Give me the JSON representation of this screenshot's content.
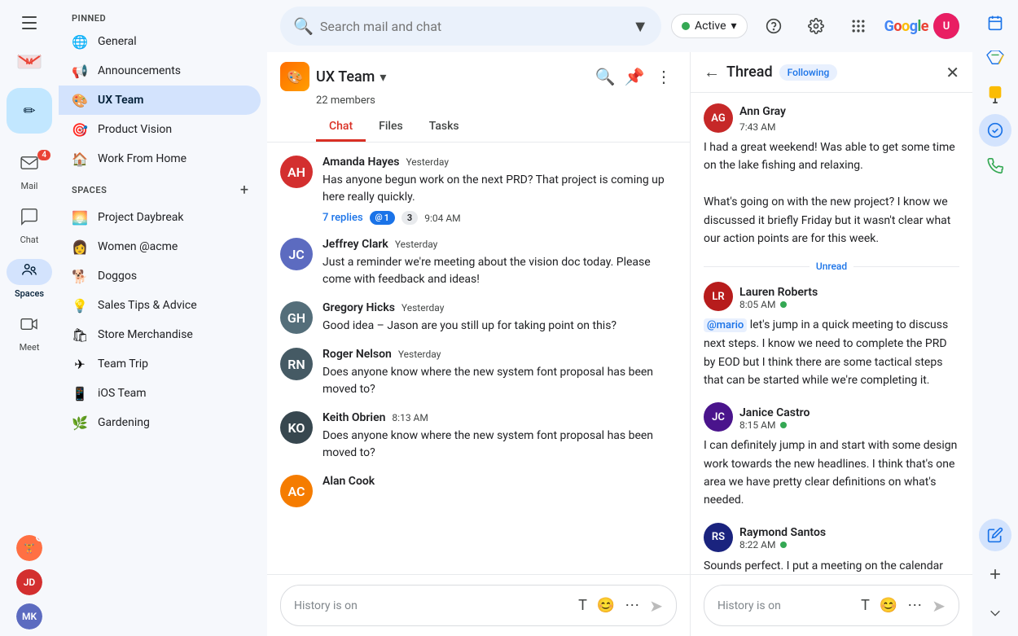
{
  "app": {
    "title": "Gmail",
    "search_placeholder": "Search mail and chat"
  },
  "top_bar": {
    "active_status": "Active",
    "help_label": "Help",
    "settings_label": "Settings",
    "apps_label": "Google apps"
  },
  "left_rail": {
    "hamburger_label": "Main menu",
    "compose_label": "Compose",
    "nav_items": [
      {
        "id": "mail",
        "label": "Mail",
        "icon": "✉",
        "badge": "4"
      },
      {
        "id": "chat",
        "label": "Chat",
        "icon": "💬",
        "badge": null
      },
      {
        "id": "spaces",
        "label": "Spaces",
        "icon": "👥",
        "active": true,
        "badge": null
      },
      {
        "id": "meet",
        "label": "Meet",
        "icon": "📹",
        "badge": null
      }
    ]
  },
  "sidebar": {
    "pinned_label": "PINNED",
    "pinned_items": [
      {
        "id": "general",
        "label": "General",
        "icon": "🌐"
      },
      {
        "id": "announcements",
        "label": "Announcements",
        "icon": "📢"
      },
      {
        "id": "ux-team",
        "label": "UX Team",
        "icon": "🎨",
        "active": true
      },
      {
        "id": "product-vision",
        "label": "Product Vision",
        "icon": "🎯"
      },
      {
        "id": "work-from-home",
        "label": "Work From Home",
        "icon": "🏠"
      }
    ],
    "spaces_label": "SPACES",
    "spaces_add": "+",
    "spaces_items": [
      {
        "id": "project-daybreak",
        "label": "Project Daybreak",
        "icon": "🌅"
      },
      {
        "id": "women-acme",
        "label": "Women @acme",
        "icon": "👩"
      },
      {
        "id": "doggos",
        "label": "Doggos",
        "icon": "🐕"
      },
      {
        "id": "sales-tips",
        "label": "Sales Tips & Advice",
        "icon": "💡"
      },
      {
        "id": "store-merchandise",
        "label": "Store Merchandise",
        "icon": "🛍"
      },
      {
        "id": "team-trip",
        "label": "Team Trip",
        "icon": "✈"
      },
      {
        "id": "ios-team",
        "label": "iOS Team",
        "icon": "📱"
      },
      {
        "id": "gardening",
        "label": "Gardening",
        "icon": "🌿"
      }
    ]
  },
  "chat_panel": {
    "space_name": "UX Team",
    "members_count": "22 members",
    "tabs": [
      {
        "id": "chat",
        "label": "Chat",
        "active": true
      },
      {
        "id": "files",
        "label": "Files",
        "active": false
      },
      {
        "id": "tasks",
        "label": "Tasks",
        "active": false
      }
    ],
    "messages": [
      {
        "id": "msg1",
        "sender": "Amanda Hayes",
        "time": "Yesterday",
        "text": "Has anyone begun work on the next PRD? That project is coming up here really quickly.",
        "replies_count": "7 replies",
        "badge1": "1",
        "badge2": "3",
        "reply_time": "9:04 AM",
        "avatar_color": "#d32f2f",
        "initials": "AH"
      },
      {
        "id": "msg2",
        "sender": "Jeffrey Clark",
        "time": "Yesterday",
        "text": "Just a reminder we're meeting about the vision doc today. Please come with feedback and ideas!",
        "avatar_color": "#5c6bc0",
        "initials": "JC"
      },
      {
        "id": "msg3",
        "sender": "Gregory Hicks",
        "time": "Yesterday",
        "text": "Good idea – Jason are you still up for taking point on this?",
        "avatar_color": "#546e7a",
        "initials": "GH"
      },
      {
        "id": "msg4",
        "sender": "Roger Nelson",
        "time": "Yesterday",
        "text": "Does anyone know where the new system font proposal has been moved to?",
        "avatar_color": "#455a64",
        "initials": "RN"
      },
      {
        "id": "msg5",
        "sender": "Keith Obrien",
        "time": "8:13 AM",
        "text": "Does anyone know where the new system font proposal has been moved to?",
        "avatar_color": "#37474f",
        "initials": "KO"
      },
      {
        "id": "msg6",
        "sender": "Alan Cook",
        "time": "",
        "text": "",
        "avatar_color": "#f57c00",
        "initials": "AC"
      }
    ],
    "input_placeholder": "History is on",
    "input_icons": [
      "format_text",
      "emoji",
      "more"
    ]
  },
  "thread_panel": {
    "title": "Thread",
    "following_label": "Following",
    "messages": [
      {
        "id": "t1",
        "sender": "Ann Gray",
        "time": "7:43 AM",
        "text": "I had a great weekend! Was able to get some time on the lake fishing and relaxing.\n\nWhat's going on with the new project? I know we discussed it briefly Friday but it wasn't clear what our action points are for this week.",
        "avatar_color": "#c62828",
        "initials": "AG",
        "online": false
      },
      {
        "id": "t2",
        "unread_divider": true,
        "sender": "Lauren Roberts",
        "time": "8:05 AM",
        "text": "@mario let's jump in a quick meeting to discuss next steps. I know we need to complete the PRD by EOD but I think there are some tactical steps that can be started while we're completing it.",
        "avatar_color": "#b71c1c",
        "initials": "LR",
        "online": true,
        "mention": "@mario"
      },
      {
        "id": "t3",
        "sender": "Janice Castro",
        "time": "8:15 AM",
        "text": "I can definitely jump in and start with some design work towards the new headlines. I think that's one area we have pretty clear definitions on what's needed.",
        "avatar_color": "#4a148c",
        "initials": "JC",
        "online": true
      },
      {
        "id": "t4",
        "sender": "Raymond Santos",
        "time": "8:22 AM",
        "text": "Sounds perfect. I put a meeting on the calendar for later this morning so we can figure out the specifics of the PRD...",
        "avatar_color": "#1a237e",
        "initials": "RS",
        "online": true
      }
    ],
    "input_placeholder": "History is on",
    "unread_label": "Unread"
  },
  "right_rail": {
    "icons": [
      {
        "id": "calendar",
        "icon": "📅",
        "active": false
      },
      {
        "id": "drive",
        "icon": "▲",
        "active": false,
        "color": "#1a73e8"
      },
      {
        "id": "keep",
        "icon": "💛",
        "active": false
      },
      {
        "id": "tasks",
        "icon": "✓",
        "active": true
      },
      {
        "id": "contacts",
        "icon": "📞",
        "active": false
      },
      {
        "id": "edit",
        "icon": "✏",
        "active": true
      }
    ]
  }
}
